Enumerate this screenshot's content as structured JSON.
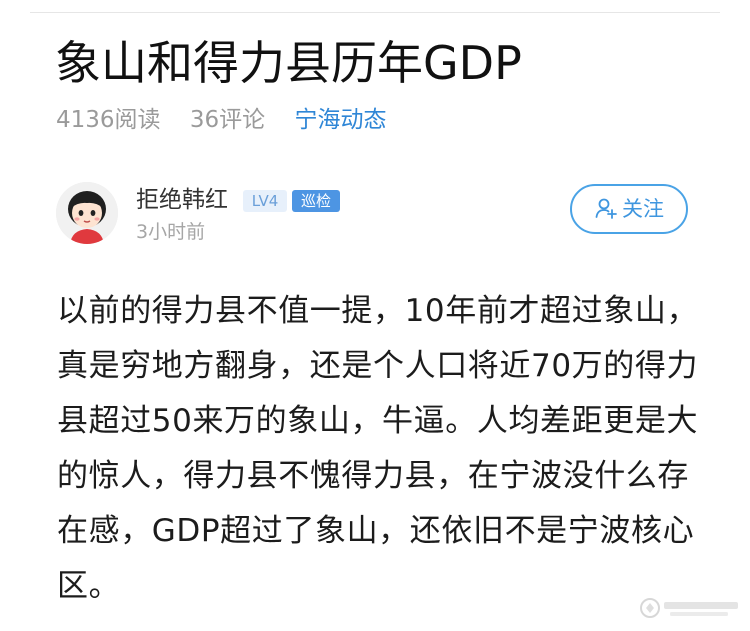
{
  "article": {
    "title": "象山和得力县历年GDP",
    "meta": {
      "reads": "4136阅读",
      "comments": "36评论",
      "source": "宁海动态"
    },
    "author": {
      "name": "拒绝韩红",
      "level_badge": "LV4",
      "role_badge": "巡检",
      "time": "3小时前",
      "follow_label": "关注"
    },
    "body": "以前的得力县不值一提，10年前才超过象山，真是穷地方翻身，还是个人口将近70万的得力县超过50来万的象山，牛逼。人均差距更是大的惊人，得力县不愧得力县，在宁波没什么存在感，GDP超过了象山，还依旧不是宁波核心区。"
  },
  "colors": {
    "accent": "#3f96df",
    "meta_gray": "#9a9a9a"
  },
  "icons": {
    "avatar": "cartoon-girl-avatar",
    "follow": "add-user-icon",
    "watermark": "site-watermark-logo"
  }
}
